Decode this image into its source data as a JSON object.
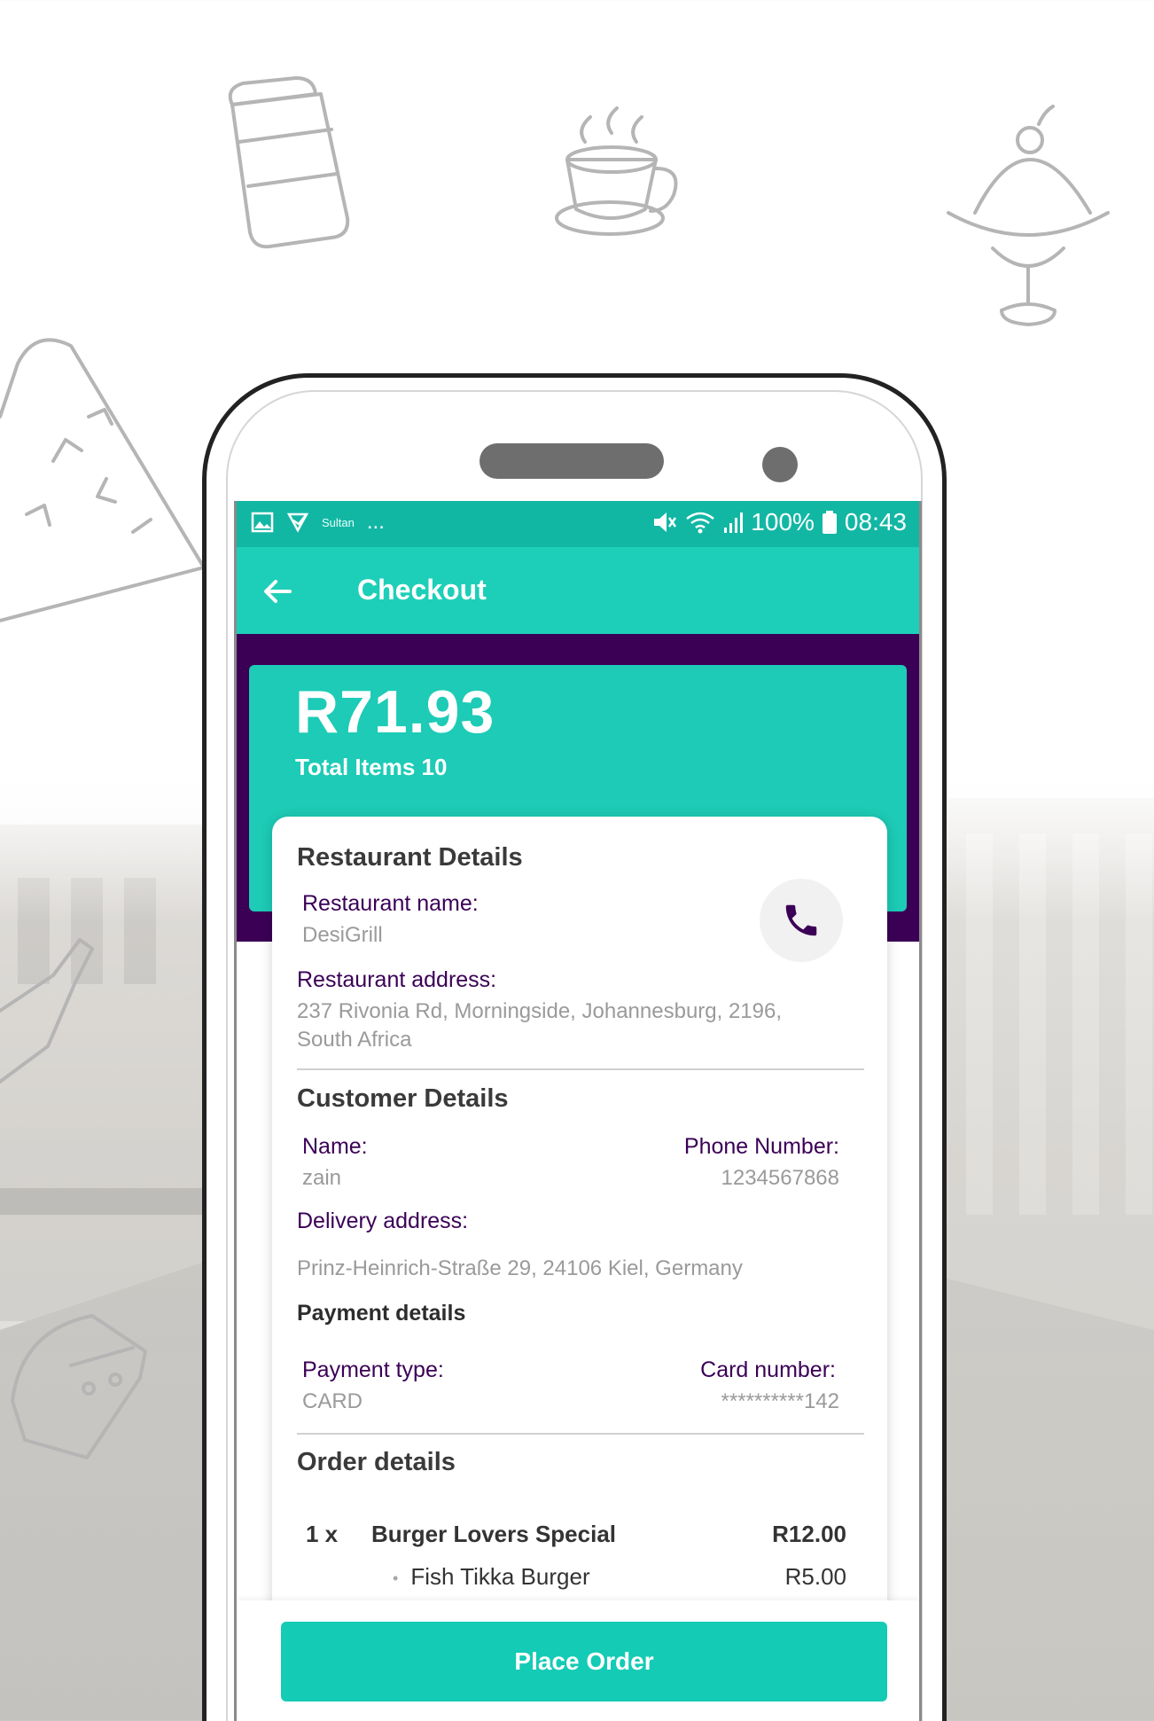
{
  "status_bar": {
    "carrier_text": "Sultan",
    "more_indicator": "...",
    "battery": "100%",
    "time": "08:43",
    "icons": [
      "gallery-icon",
      "app-notification-icon",
      "mute-icon",
      "wifi-icon",
      "signal-icon",
      "battery-icon"
    ]
  },
  "app_bar": {
    "title": "Checkout",
    "back_icon": "arrow-left-icon"
  },
  "summary": {
    "total": "R71.93",
    "total_items": "Total Items 10"
  },
  "restaurant": {
    "section_title": "Restaurant Details",
    "name_label": "Restaurant name:",
    "name_value": "DesiGrill",
    "address_label": "Restaurant address:",
    "address_line1": "237 Rivonia Rd, Morningside, Johannesburg, 2196,",
    "address_line2": "South Africa",
    "call_icon": "phone-icon"
  },
  "customer": {
    "section_title": "Customer Details",
    "name_label": "Name:",
    "name_value": "zain",
    "phone_label": "Phone Number:",
    "phone_value": "1234567868",
    "delivery_label": "Delivery address:",
    "delivery_value": "Prinz-Heinrich-Straße 29, 24106 Kiel, Germany"
  },
  "payment": {
    "section_title": "Payment details",
    "type_label": "Payment type:",
    "type_value": "CARD",
    "card_label": "Card number:",
    "card_value": "**********142"
  },
  "order": {
    "section_title": "Order details",
    "items": [
      {
        "qty": "1 x",
        "name": "Burger Lovers Special",
        "price": "R12.00",
        "extras": [
          {
            "name": "Fish Tikka Burger",
            "price": "R5.00"
          }
        ]
      }
    ]
  },
  "actions": {
    "place_order": "Place Order"
  },
  "colors": {
    "status_bar": "#12b7a4",
    "app_bar": "#1dcfb8",
    "accent_purple": "#3b0056",
    "button": "#14cbb5"
  }
}
